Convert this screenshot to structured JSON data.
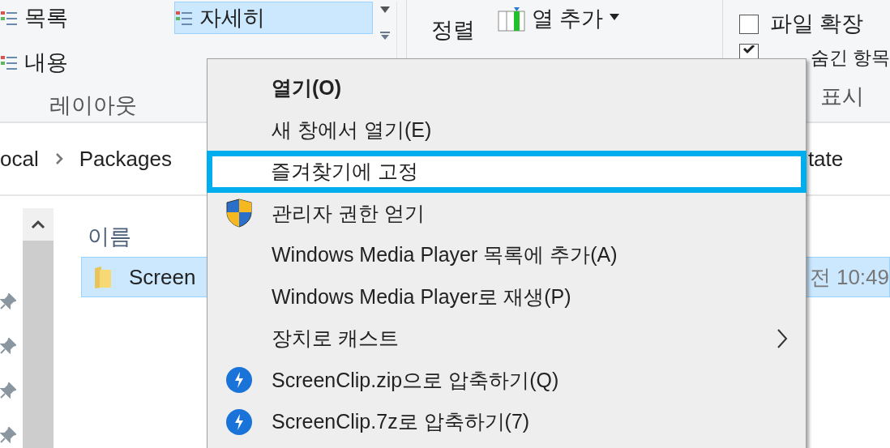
{
  "ribbon": {
    "layout_group": {
      "items": [
        {
          "label": "목록",
          "selected": false
        },
        {
          "label": "내용",
          "selected": false
        },
        {
          "label": "자세히",
          "selected": true
        }
      ],
      "label": "레이아웃"
    },
    "sort_group": {
      "sort_by": "정렬",
      "add_column": "열 추가"
    },
    "show_group": {
      "options": [
        {
          "label": "파일 확장",
          "checked": false
        },
        {
          "label": "숨긴 항목",
          "checked": true
        }
      ],
      "label": "표시"
    }
  },
  "breadcrumb": [
    "ocal",
    "Packages",
    "tate"
  ],
  "file_list": {
    "columns": [
      "이름"
    ],
    "rows": [
      {
        "name": "Screen",
        "modified": "전 10:49",
        "selected": true
      }
    ]
  },
  "context_menu": {
    "items": [
      {
        "label": "열기(O)",
        "kind": "plain",
        "bold": true,
        "selected": false,
        "submenu": false
      },
      {
        "label": "새 창에서 열기(E)",
        "kind": "plain",
        "bold": false,
        "selected": false,
        "submenu": false
      },
      {
        "label": "즐겨찾기에 고정",
        "kind": "plain",
        "bold": false,
        "selected": true,
        "submenu": false
      },
      {
        "label": "관리자 권한 얻기",
        "kind": "shield",
        "bold": false,
        "selected": false,
        "submenu": false
      },
      {
        "label": "Windows Media Player 목록에 추가(A)",
        "kind": "plain",
        "bold": false,
        "selected": false,
        "submenu": false
      },
      {
        "label": "Windows Media Player로 재생(P)",
        "kind": "plain",
        "bold": false,
        "selected": false,
        "submenu": false
      },
      {
        "label": "장치로 캐스트",
        "kind": "plain",
        "bold": false,
        "selected": false,
        "submenu": true
      },
      {
        "label": "ScreenClip.zip으로 압축하기(Q)",
        "kind": "archive",
        "bold": false,
        "selected": false,
        "submenu": false
      },
      {
        "label": "ScreenClip.7z로 압축하기(7)",
        "kind": "archive",
        "bold": false,
        "selected": false,
        "submenu": false
      }
    ]
  }
}
